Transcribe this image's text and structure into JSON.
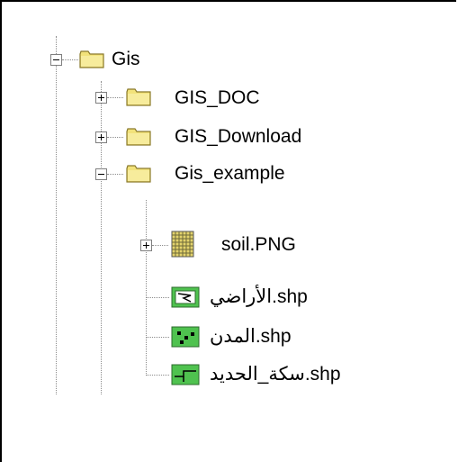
{
  "tree": {
    "root": {
      "label": "Gis",
      "expanded": true,
      "icon": "folder-open-icon"
    },
    "children": [
      {
        "label": "GIS_DOC",
        "expanded": false,
        "icon": "folder-icon"
      },
      {
        "label": "GIS_Download",
        "expanded": false,
        "icon": "folder-icon"
      },
      {
        "label": "Gis_example",
        "expanded": true,
        "icon": "folder-icon"
      }
    ],
    "example_items": [
      {
        "label": "soil.PNG",
        "icon": "raster-grid-icon",
        "expandable": true
      },
      {
        "label": "الأراضي.shp",
        "icon": "polygon-shapefile-icon"
      },
      {
        "label": "المدن.shp",
        "icon": "point-shapefile-icon"
      },
      {
        "label": "سكة_الحديد.shp",
        "icon": "line-shapefile-icon"
      }
    ]
  },
  "colors": {
    "folder_yellow": "#f2e27a",
    "folder_border": "#8a7a2c",
    "shp_green": "#4fc24f",
    "raster_yellow": "#e3d36c",
    "guide_gray": "#8c8c8c"
  }
}
